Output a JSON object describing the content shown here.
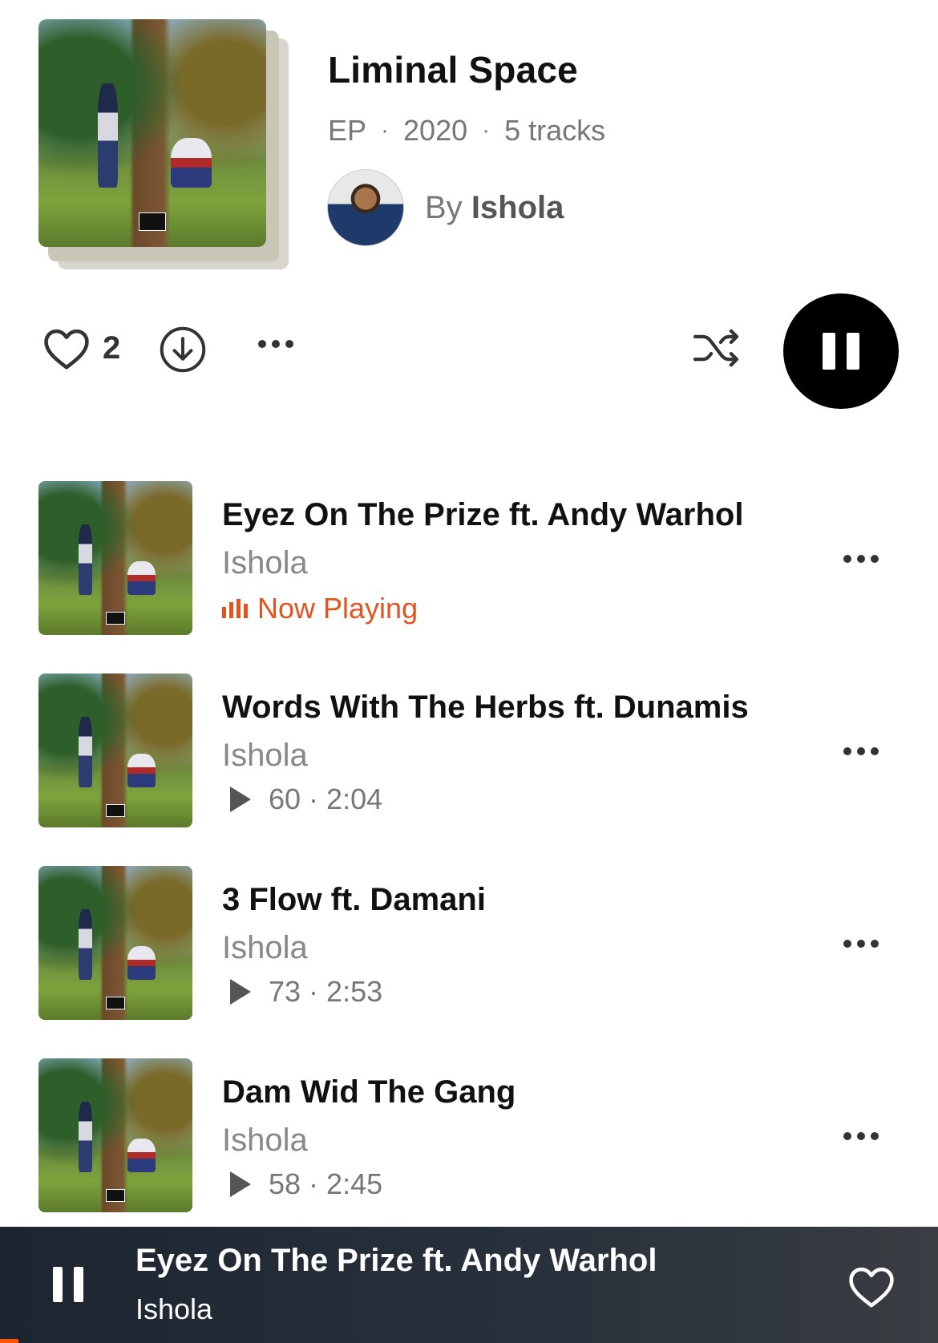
{
  "album": {
    "title": "Liminal Space",
    "type": "EP",
    "year": "2020",
    "track_count": "5 tracks",
    "by_prefix": "By",
    "artist": "Ishola"
  },
  "actions": {
    "like_count": "2"
  },
  "tracks": [
    {
      "title": "Eyez On The Prize ft. Andy Warhol",
      "artist": "Ishola",
      "status": "Now Playing"
    },
    {
      "title": "Words With The Herbs ft. Dunamis",
      "artist": "Ishola",
      "plays": "60",
      "duration": "2:04"
    },
    {
      "title": "3 Flow ft. Damani",
      "artist": "Ishola",
      "plays": "73",
      "duration": "2:53"
    },
    {
      "title": "Dam Wid The Gang",
      "artist": "Ishola",
      "plays": "58",
      "duration": "2:45"
    }
  ],
  "mini_player": {
    "title": "Eyez On The Prize ft. Andy Warhol",
    "artist": "Ishola",
    "progress": 0.02
  },
  "colors": {
    "accent": "#e2531f",
    "mini_player_bg": "#1c2530",
    "play_button": "#000000"
  }
}
